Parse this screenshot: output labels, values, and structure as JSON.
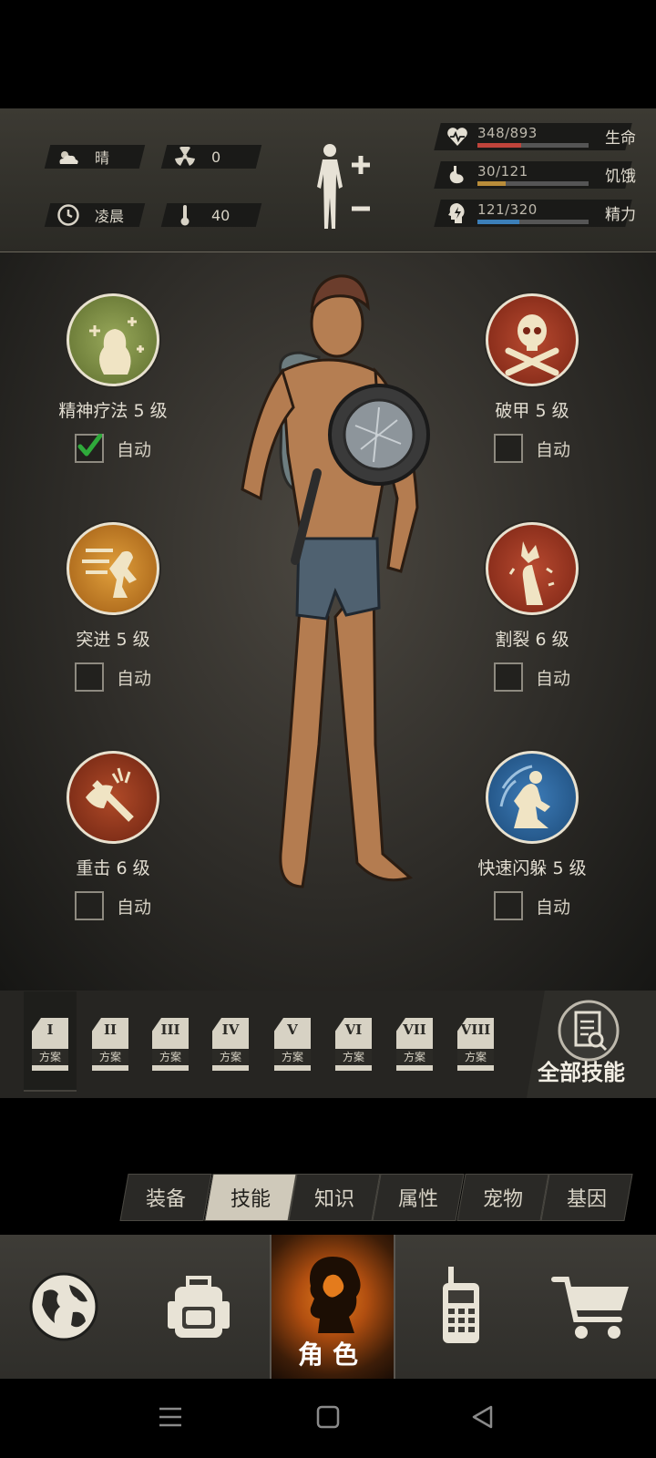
{
  "status": {
    "weather": "晴",
    "radiation": "0",
    "time_of_day": "凌晨",
    "temperature": "40",
    "body_toggle_icons": [
      "body-icon",
      "plus-icon",
      "minus-icon"
    ],
    "stats": [
      {
        "icon": "heart-pulse-icon",
        "value": "348/893",
        "label": "生命",
        "fill": 0.39,
        "color": "#c0443b"
      },
      {
        "icon": "stomach-icon",
        "value": "30/121",
        "label": "饥饿",
        "fill": 0.25,
        "color": "#b98d3a"
      },
      {
        "icon": "brain-bolt-icon",
        "value": "121/320",
        "label": "精力",
        "fill": 0.38,
        "color": "#3c7fb8"
      }
    ]
  },
  "skills": {
    "left": [
      {
        "name": "精神疗法 5 级",
        "icon": "mental-therapy-icon",
        "auto_label": "自动",
        "auto_checked": true
      },
      {
        "name": "突进 5 级",
        "icon": "dash-icon",
        "auto_label": "自动",
        "auto_checked": false
      },
      {
        "name": "重击 6 级",
        "icon": "heavy-strike-icon",
        "auto_label": "自动",
        "auto_checked": false
      }
    ],
    "right": [
      {
        "name": "破甲 5 级",
        "icon": "skull-crossbones-icon",
        "auto_label": "自动",
        "auto_checked": false
      },
      {
        "name": "割裂 6 级",
        "icon": "lacerate-icon",
        "auto_label": "自动",
        "auto_checked": false
      },
      {
        "name": "快速闪躲 5 级",
        "icon": "quick-dodge-icon",
        "auto_label": "自动",
        "auto_checked": false
      }
    ]
  },
  "loadout": {
    "plan_label": "方案",
    "plans": [
      "I",
      "II",
      "III",
      "IV",
      "V",
      "VI",
      "VII",
      "VIII"
    ],
    "selected": 0,
    "all_skills_label": "全部技能"
  },
  "tabs": {
    "items": [
      "装备",
      "技能",
      "知识",
      "属性",
      "宠物",
      "基因"
    ],
    "active": 1
  },
  "nav": {
    "role_label": "角色",
    "items": [
      "globe-icon",
      "backpack-icon",
      "character-icon",
      "radio-icon",
      "cart-icon"
    ]
  },
  "system_nav": [
    "menu-icon",
    "home-icon",
    "back-icon"
  ]
}
